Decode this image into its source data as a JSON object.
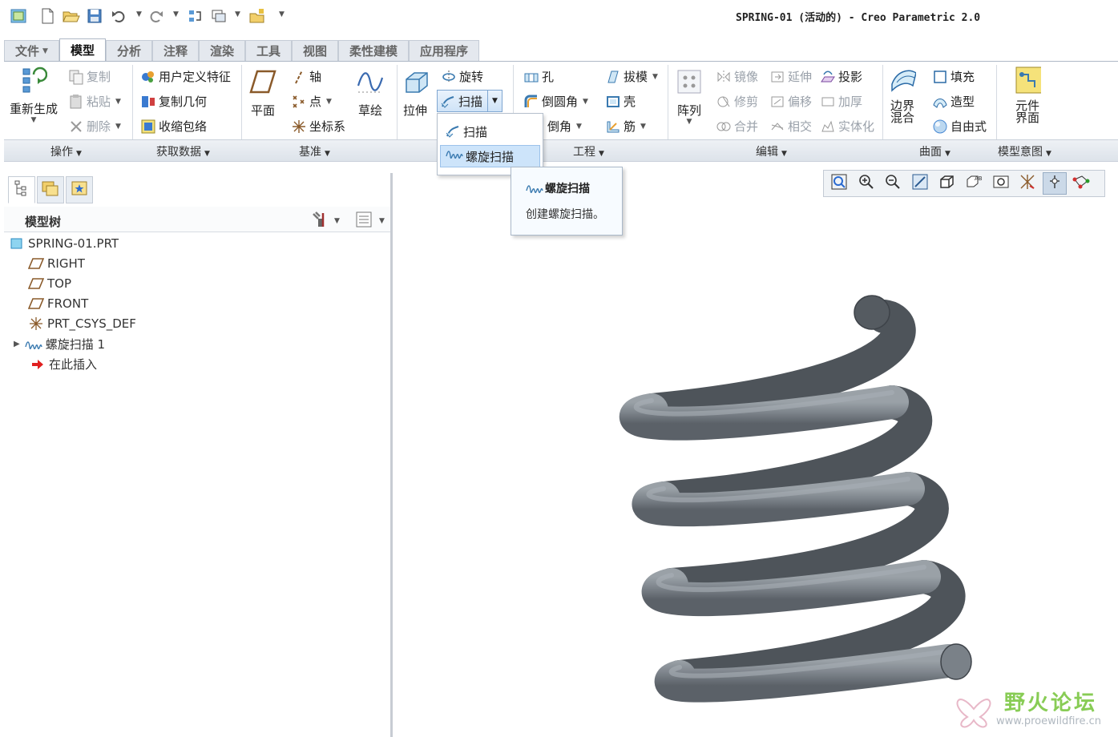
{
  "window": {
    "title": "SPRING-01 (活动的) - Creo Parametric 2.0"
  },
  "tabs": [
    {
      "label": "文件",
      "dropdown": true,
      "active": false
    },
    {
      "label": "模型",
      "active": true
    },
    {
      "label": "分析",
      "active": false
    },
    {
      "label": "注释",
      "active": false
    },
    {
      "label": "渲染",
      "active": false
    },
    {
      "label": "工具",
      "active": false
    },
    {
      "label": "视图",
      "active": false
    },
    {
      "label": "柔性建模",
      "active": false
    },
    {
      "label": "应用程序",
      "active": false
    }
  ],
  "ribbon": {
    "operations": {
      "regenerate": "重新生成",
      "copy": "复制",
      "paste": "粘贴",
      "delete": "删除",
      "group": "操作"
    },
    "get_data": {
      "user_feature": "用户定义特征",
      "copy_geometry": "复制几何",
      "shrinkwrap": "收缩包络",
      "group": "获取数据"
    },
    "datum": {
      "plane": "平面",
      "axis": "轴",
      "point": "点",
      "csys": "坐标系",
      "sketch": "草绘",
      "group": "基准"
    },
    "shapes": {
      "extrude": "拉伸",
      "revolve": "旋转",
      "sweep": "扫描"
    },
    "engineering": {
      "hole": "孔",
      "round": "倒圆角",
      "chamfer": "倒角",
      "draft": "拔模",
      "shell": "壳",
      "rib": "筋",
      "group": "工程"
    },
    "editing": {
      "pattern": "阵列",
      "mirror": "镜像",
      "trim": "修剪",
      "merge": "合并",
      "extend": "延伸",
      "offset": "偏移",
      "intersect": "相交",
      "project": "投影",
      "thicken": "加厚",
      "solidify": "实体化",
      "group": "编辑"
    },
    "surfaces": {
      "boundary_blend": "边界混合",
      "fill": "填充",
      "style": "造型",
      "freestyle": "自由式",
      "group": "曲面"
    },
    "model_intent": {
      "component_interface": "元件界面",
      "group": "模型意图"
    }
  },
  "sweep_menu": {
    "items": [
      {
        "label": "扫描",
        "hover": false
      },
      {
        "label": "螺旋扫描",
        "hover": true
      }
    ],
    "tooltip": {
      "title": "螺旋扫描",
      "description": "创建螺旋扫描。"
    }
  },
  "model_tree": {
    "title": "模型树",
    "items": [
      {
        "label": "SPRING-01.PRT",
        "icon": "part-icon"
      },
      {
        "label": "RIGHT",
        "icon": "datum-plane-icon"
      },
      {
        "label": "TOP",
        "icon": "datum-plane-icon"
      },
      {
        "label": "FRONT",
        "icon": "datum-plane-icon"
      },
      {
        "label": "PRT_CSYS_DEF",
        "icon": "csys-icon"
      },
      {
        "label": "螺旋扫描 1",
        "icon": "helical-sweep-icon",
        "expandable": true
      },
      {
        "label": "在此插入",
        "icon": "insert-here-icon"
      }
    ]
  },
  "view_toolbar": {
    "buttons": [
      "refit-icon",
      "zoom-in-icon",
      "zoom-out-icon",
      "repaint-icon",
      "display-style-icon",
      "saved-views-icon",
      "view-manager-icon",
      "datum-display-icon",
      "spin-center-icon",
      "annotation-display-icon"
    ]
  },
  "watermark": {
    "text": "野火论坛",
    "url": "www.proewildfire.cn"
  },
  "colors": {
    "accent": "#4a8ad4",
    "spring": "#7c838a",
    "hover": "#cde4fa",
    "watermark": "#88cc55"
  }
}
